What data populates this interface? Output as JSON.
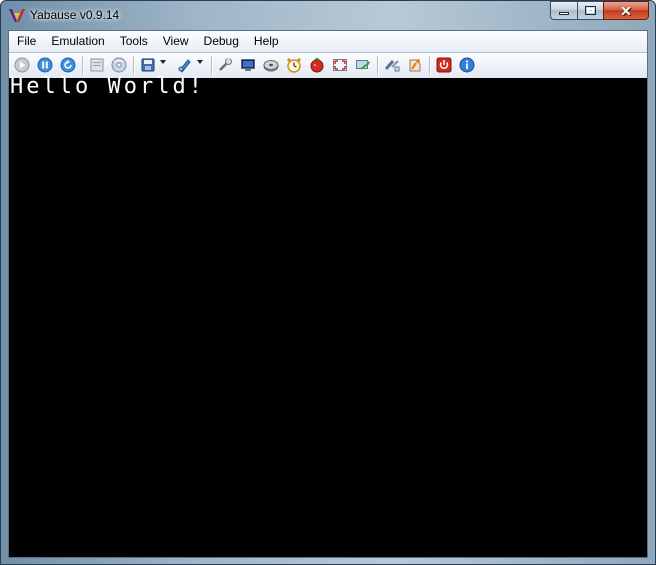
{
  "window": {
    "title": "Yabause v0.9.14"
  },
  "menubar": {
    "items": [
      "File",
      "Emulation",
      "Tools",
      "View",
      "Debug",
      "Help"
    ]
  },
  "toolbar": {
    "icons": [
      "run-icon",
      "pause-icon",
      "reset-icon",
      "open-cd-image-icon",
      "open-disc-icon",
      "save-state-icon",
      "load-state-icon",
      "settings-icon",
      "screenshot-icon",
      "cd-icon",
      "clock-icon",
      "cheats-icon",
      "fullscreen-icon",
      "memory-transfer-icon",
      "transfer-icon",
      "backup-ram-icon",
      "quit-icon",
      "about-icon"
    ]
  },
  "screen": {
    "text": "Hello World!"
  },
  "colors": {
    "screen_bg": "#000000",
    "text": "#ffffff",
    "title_gradient": "#9fb6c8"
  }
}
